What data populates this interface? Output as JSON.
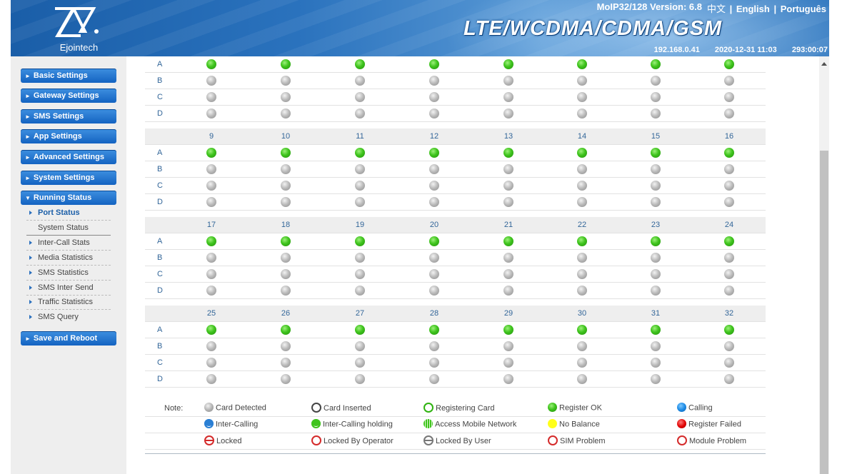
{
  "header": {
    "brand": "Ejointech",
    "version": "MoIP32/128 Version: 6.8",
    "lang_cn": "中文",
    "sep1": "|",
    "lang_en": "English",
    "sep2": "|",
    "lang_pt": "Português",
    "tagline": "LTE/WCDMA/CDMA/GSM",
    "ip": "192.168.0.41",
    "datetime": "2020-12-31 11:03",
    "uptime": "293:00:07"
  },
  "sidebar": {
    "menu": [
      "Basic Settings",
      "Gateway Settings",
      "SMS Settings",
      "App Settings",
      "Advanced Settings",
      "System Settings",
      "Running Status"
    ],
    "running_sub": [
      "Port Status",
      "System Status",
      "Inter-Call Stats",
      "Media Statistics",
      "SMS Statistics",
      "SMS Inter Send",
      "Traffic Statistics",
      "SMS Query"
    ],
    "save": "Save and Reboot"
  },
  "slots": [
    "A",
    "B",
    "C",
    "D"
  ],
  "groups": [
    {
      "ports": [],
      "status": {
        "A": "green",
        "B": "gray",
        "C": "gray",
        "D": "gray"
      }
    },
    {
      "ports": [
        "9",
        "10",
        "11",
        "12",
        "13",
        "14",
        "15",
        "16"
      ],
      "status": {
        "A": "green",
        "B": "gray",
        "C": "gray",
        "D": "gray"
      }
    },
    {
      "ports": [
        "17",
        "18",
        "19",
        "20",
        "21",
        "22",
        "23",
        "24"
      ],
      "status": {
        "A": "green",
        "B": "gray",
        "C": "gray",
        "D": "gray"
      }
    },
    {
      "ports": [
        "25",
        "26",
        "27",
        "28",
        "29",
        "30",
        "31",
        "32"
      ],
      "status": {
        "A": "green",
        "B": "gray",
        "C": "gray",
        "D": "gray"
      }
    }
  ],
  "legend": {
    "note": "Note:",
    "items": [
      [
        "Card Detected",
        "Card Inserted",
        "Registering Card",
        "Register OK",
        "Calling"
      ],
      [
        "Inter-Calling",
        "Inter-Calling holding",
        "Access Mobile Network",
        "No Balance",
        "Register Failed"
      ],
      [
        "Locked",
        "Locked By Operator",
        "Locked By User",
        "SIM Problem",
        "Module Problem"
      ]
    ]
  }
}
